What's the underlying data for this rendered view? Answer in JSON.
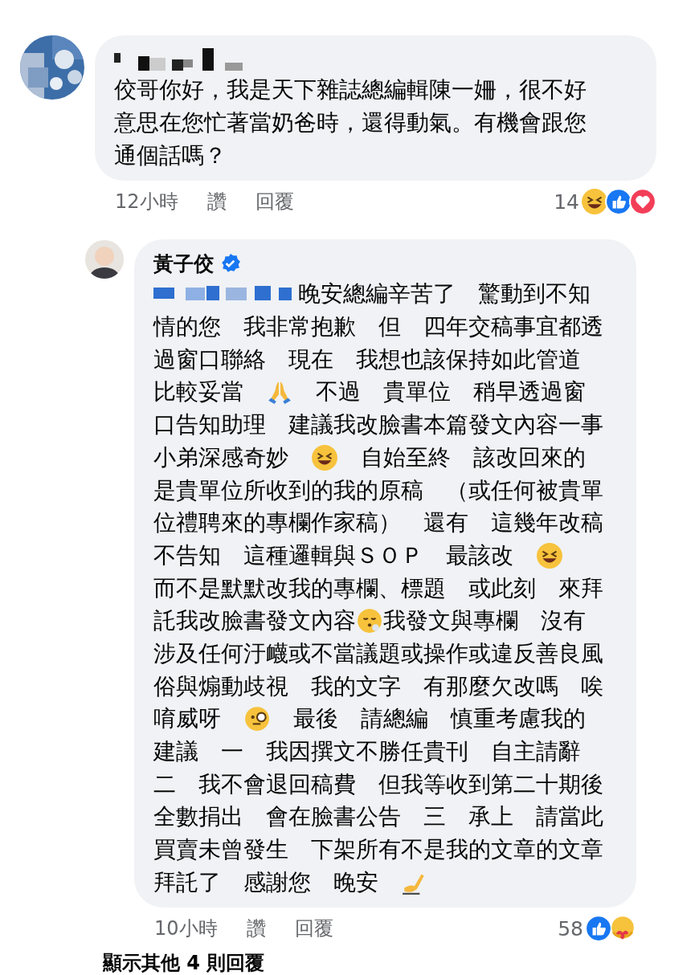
{
  "comments": [
    {
      "author_redacted": true,
      "avatar": {
        "kind": "picture"
      },
      "verified": false,
      "lines": [
        [
          {
            "kind": "text",
            "text": "佼哥你好，我是天下雜誌總編輯陳一姍，很不好"
          }
        ],
        [
          {
            "kind": "text",
            "text": "意思在您忙著當奶爸時，還得動氣。有機會跟您"
          }
        ],
        [
          {
            "kind": "text",
            "text": "通個話嗎？"
          }
        ]
      ],
      "time": "12小時",
      "like": "讚",
      "reply": "回覆",
      "reaction_count": "14",
      "reactions": [
        {
          "kind": "laugh"
        },
        {
          "kind": "like"
        },
        {
          "kind": "love"
        }
      ],
      "children": [
        {
          "author": "黃子佼",
          "author_redacted": false,
          "avatar": {
            "kind": "person"
          },
          "verified": true,
          "lines": [
            [
              {
                "kind": "redacted"
              },
              {
                "kind": "text",
                "text": "晚安總編辛苦了　驚動到不知"
              }
            ],
            [
              {
                "kind": "text",
                "text": "情的您　我非常抱歉　但　四年交稿事宜都透"
              }
            ],
            [
              {
                "kind": "text",
                "text": "過窗口聯絡　現在　我想也該保持如此管道"
              }
            ],
            [
              {
                "kind": "text",
                "text": "比較妥當　"
              },
              {
                "kind": "pray"
              },
              {
                "kind": "text",
                "text": "　不過　貴單位　稍早透過窗"
              }
            ],
            [
              {
                "kind": "text",
                "text": "口告知助理　建議我改臉書本篇發文內容一事"
              }
            ],
            [
              {
                "kind": "text",
                "text": "小弟深感奇妙　"
              },
              {
                "kind": "laugh"
              },
              {
                "kind": "text",
                "text": "　自始至終　該改回來的"
              }
            ],
            [
              {
                "kind": "text",
                "text": "是貴單位所收到的我的原稿　（或任何被貴單"
              }
            ],
            [
              {
                "kind": "text",
                "text": "位禮聘來的專欄作家稿）　還有　這幾年改稿"
              }
            ],
            [
              {
                "kind": "text",
                "text": "不告知　這種邏輯與ＳＯＰ　最該改　"
              },
              {
                "kind": "laugh"
              }
            ],
            [
              {
                "kind": "text",
                "text": "而不是默默改我的專欄、標題　或此刻　來拜"
              }
            ],
            [
              {
                "kind": "text",
                "text": "託我改臉書發文內容"
              },
              {
                "kind": "sigh"
              },
              {
                "kind": "text",
                "text": "我發文與專欄　沒有"
              }
            ],
            [
              {
                "kind": "text",
                "text": "涉及任何汙衊或不當議題或操作或違反善良風"
              }
            ],
            [
              {
                "kind": "text",
                "text": "俗與煽動歧視　我的文字　有那麼欠改嗎　唉"
              }
            ],
            [
              {
                "kind": "text",
                "text": "唷威呀　"
              },
              {
                "kind": "monocle"
              },
              {
                "kind": "text",
                "text": "　最後　請總編　慎重考慮我的"
              }
            ],
            [
              {
                "kind": "text",
                "text": "建議　一　我因撰文不勝任貴刊　自主請辭"
              }
            ],
            [
              {
                "kind": "text",
                "text": "二　我不會退回稿費　但我等收到第二十期後"
              }
            ],
            [
              {
                "kind": "text",
                "text": "全數捐出　會在臉書公告　三　承上　請當此"
              }
            ],
            [
              {
                "kind": "text",
                "text": "買賣未曾發生　下架所有不是我的文章的文章"
              }
            ],
            [
              {
                "kind": "text",
                "text": "拜託了　感謝您　晚安　"
              },
              {
                "kind": "write"
              }
            ]
          ],
          "time": "10小時",
          "like": "讚",
          "reply": "回覆",
          "reaction_count": "58",
          "reactions": [
            {
              "kind": "like"
            },
            {
              "kind": "care"
            }
          ]
        }
      ]
    }
  ],
  "more_replies": "顯示其他 4 則回覆"
}
